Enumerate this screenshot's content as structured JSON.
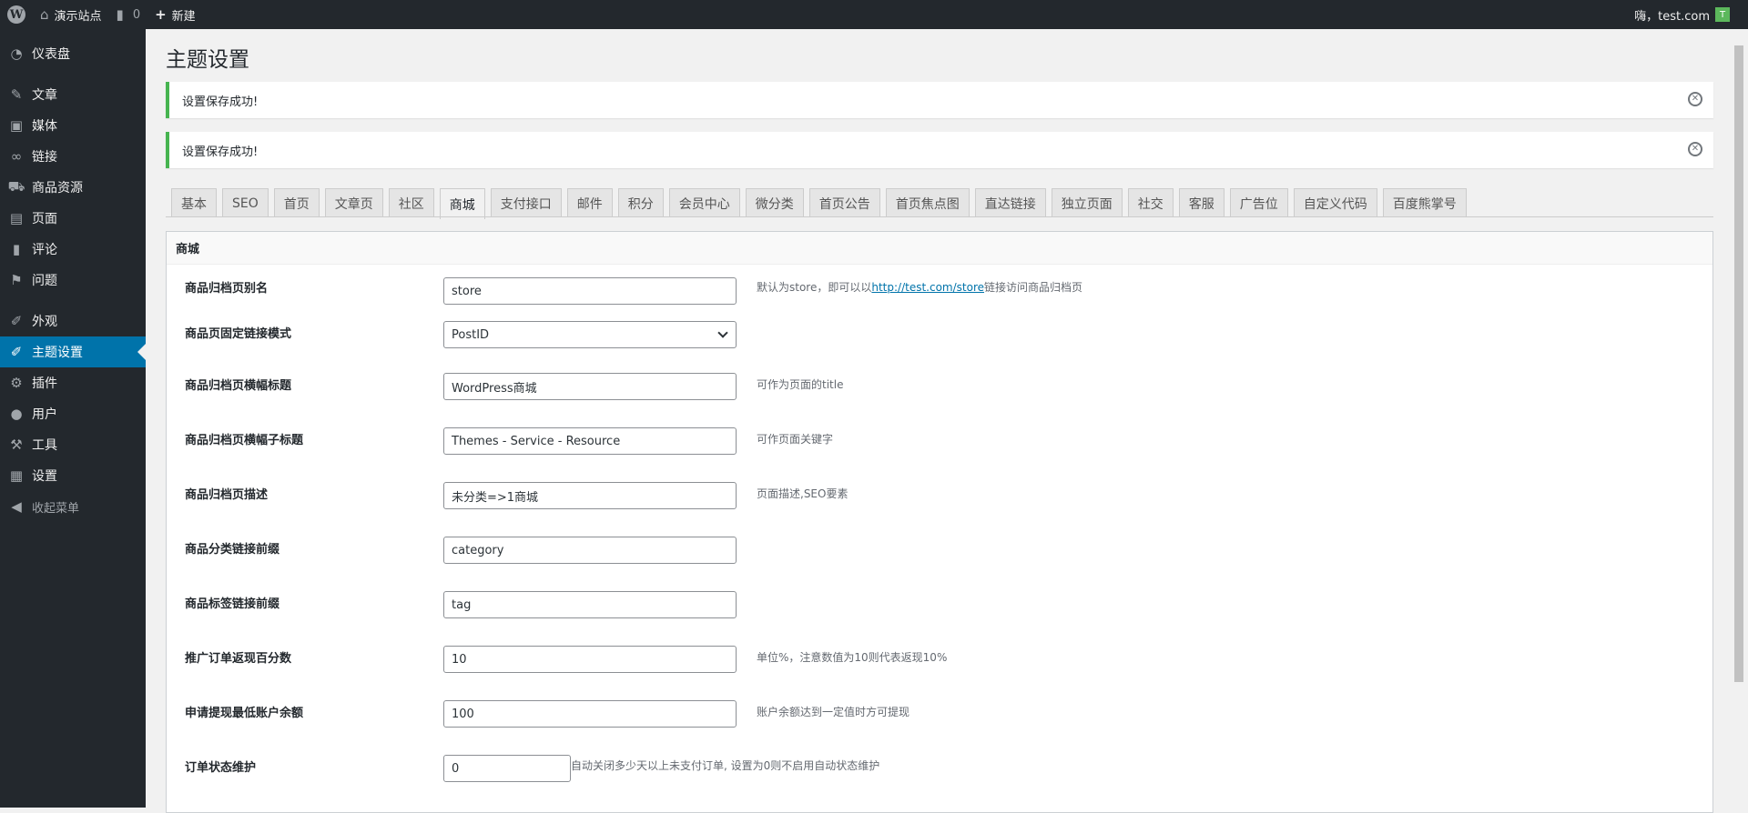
{
  "adminbar": {
    "site_name": "演示站点",
    "comments_count": "0",
    "new_label": "新建",
    "greeting": "嗨，test.com",
    "avatar_letter": "T"
  },
  "sidebar": {
    "items": [
      {
        "label": "仪表盘",
        "icon": "dashboard-icon"
      },
      {
        "label": "文章",
        "icon": "pin-icon"
      },
      {
        "label": "媒体",
        "icon": "media-icon"
      },
      {
        "label": "链接",
        "icon": "link-icon"
      },
      {
        "label": "商品资源",
        "icon": "cart-icon"
      },
      {
        "label": "页面",
        "icon": "page-icon"
      },
      {
        "label": "评论",
        "icon": "comment-icon"
      },
      {
        "label": "问题",
        "icon": "flag-icon"
      },
      {
        "label": "外观",
        "icon": "brush-icon"
      },
      {
        "label": "主题设置",
        "icon": "brush-icon",
        "active": true
      },
      {
        "label": "插件",
        "icon": "plugin-icon"
      },
      {
        "label": "用户",
        "icon": "user-icon"
      },
      {
        "label": "工具",
        "icon": "wrench-icon"
      },
      {
        "label": "设置",
        "icon": "settings-icon"
      },
      {
        "label": "收起菜单",
        "icon": "collapse-icon"
      }
    ]
  },
  "page": {
    "title": "主题设置",
    "notices": [
      "设置保存成功!",
      "设置保存成功!"
    ]
  },
  "tabs": [
    "基本",
    "SEO",
    "首页",
    "文章页",
    "社区",
    "商城",
    "支付接口",
    "邮件",
    "积分",
    "会员中心",
    "微分类",
    "首页公告",
    "首页焦点图",
    "直达链接",
    "独立页面",
    "社交",
    "客服",
    "广告位",
    "自定义代码",
    "百度熊掌号"
  ],
  "active_tab": "商城",
  "panel": {
    "heading": "商城",
    "rows": [
      {
        "label": "商品归档页别名",
        "value": "store",
        "desc_pre": "默认为store，即可以以",
        "desc_link": "http://test.com/store",
        "desc_post": "链接访问商品归档页"
      },
      {
        "label": "商品页固定链接模式",
        "value": "PostID",
        "type": "select"
      },
      {
        "label": "商品归档页横幅标题",
        "value": "WordPress商城",
        "desc": "可作为页面的title"
      },
      {
        "label": "商品归档页横幅子标题",
        "value": "Themes - Service - Resource",
        "desc": "可作页面关键字"
      },
      {
        "label": "商品归档页描述",
        "value": "未分类=>1商城",
        "desc": "页面描述,SEO要素"
      },
      {
        "label": "商品分类链接前缀",
        "value": "category"
      },
      {
        "label": "商品标签链接前缀",
        "value": "tag"
      },
      {
        "label": "推广订单返现百分数",
        "value": "10",
        "desc": "单位%，注意数值为10则代表返现10%"
      },
      {
        "label": "申请提现最低账户余额",
        "value": "100",
        "desc": "账户余额达到一定值时方可提现"
      },
      {
        "label": "订单状态维护",
        "value": "0",
        "desc": "自动关闭多少天以上未支付订单, 设置为0则不启用自动状态维护"
      }
    ]
  }
}
